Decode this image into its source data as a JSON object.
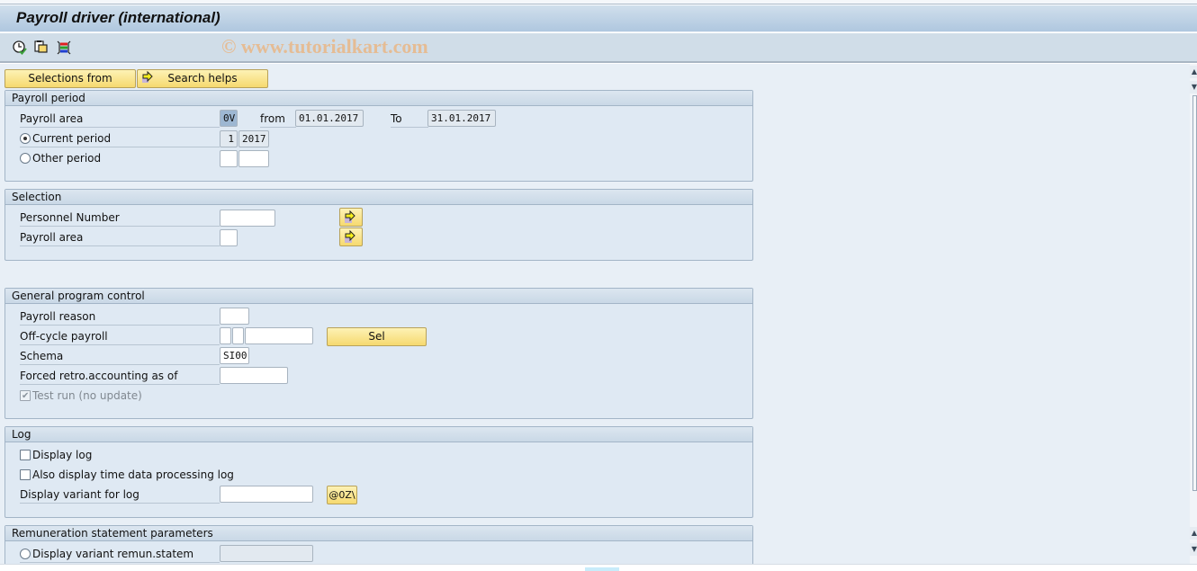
{
  "window": {
    "title": "Payroll driver (international)",
    "watermark": "© www.tutorialkart.com"
  },
  "toolbar": {
    "icons": [
      "execute-clock-icon",
      "copy-variant-icon",
      "selection-options-icon"
    ]
  },
  "actions": {
    "selections_from_label": "Selections from",
    "search_helps_label": "Search helps"
  },
  "payroll_period": {
    "header": "Payroll period",
    "payroll_area_label": "Payroll area",
    "payroll_area_value": "0V",
    "from_label": "from",
    "from_value": "01.01.2017",
    "to_label": "To",
    "to_value": "31.01.2017",
    "current_period_label": "Current period",
    "current_period_selected": true,
    "current_period_number": "1",
    "current_period_year": "2017",
    "other_period_label": "Other period",
    "other_period_selected": false,
    "other_period_number": "",
    "other_period_year": ""
  },
  "selection": {
    "header": "Selection",
    "personnel_number_label": "Personnel Number",
    "personnel_number_value": "",
    "payroll_area_label": "Payroll area",
    "payroll_area_value": ""
  },
  "general_program_control": {
    "header": "General program control",
    "payroll_reason_label": "Payroll reason",
    "payroll_reason_value": "",
    "off_cycle_label": "Off-cycle payroll",
    "off_cycle_values": [
      "",
      "",
      ""
    ],
    "sel_button_label": "Sel",
    "schema_label": "Schema",
    "schema_value": "SI00",
    "forced_retro_label": "Forced retro.accounting as of",
    "forced_retro_value": "",
    "test_run_label": "Test run (no update)",
    "test_run_checked": true,
    "test_run_disabled": true
  },
  "log": {
    "header": "Log",
    "display_log_label": "Display log",
    "display_log_checked": false,
    "time_data_log_label": "Also display time data processing log",
    "time_data_log_checked": false,
    "display_variant_label": "Display variant for log",
    "display_variant_value": "",
    "variant_button_label": "@0Z\\"
  },
  "remuneration": {
    "header": "Remuneration statement parameters",
    "display_variant_label": "Display variant remun.statem",
    "display_variant_selected": false,
    "display_variant_value": ""
  }
}
